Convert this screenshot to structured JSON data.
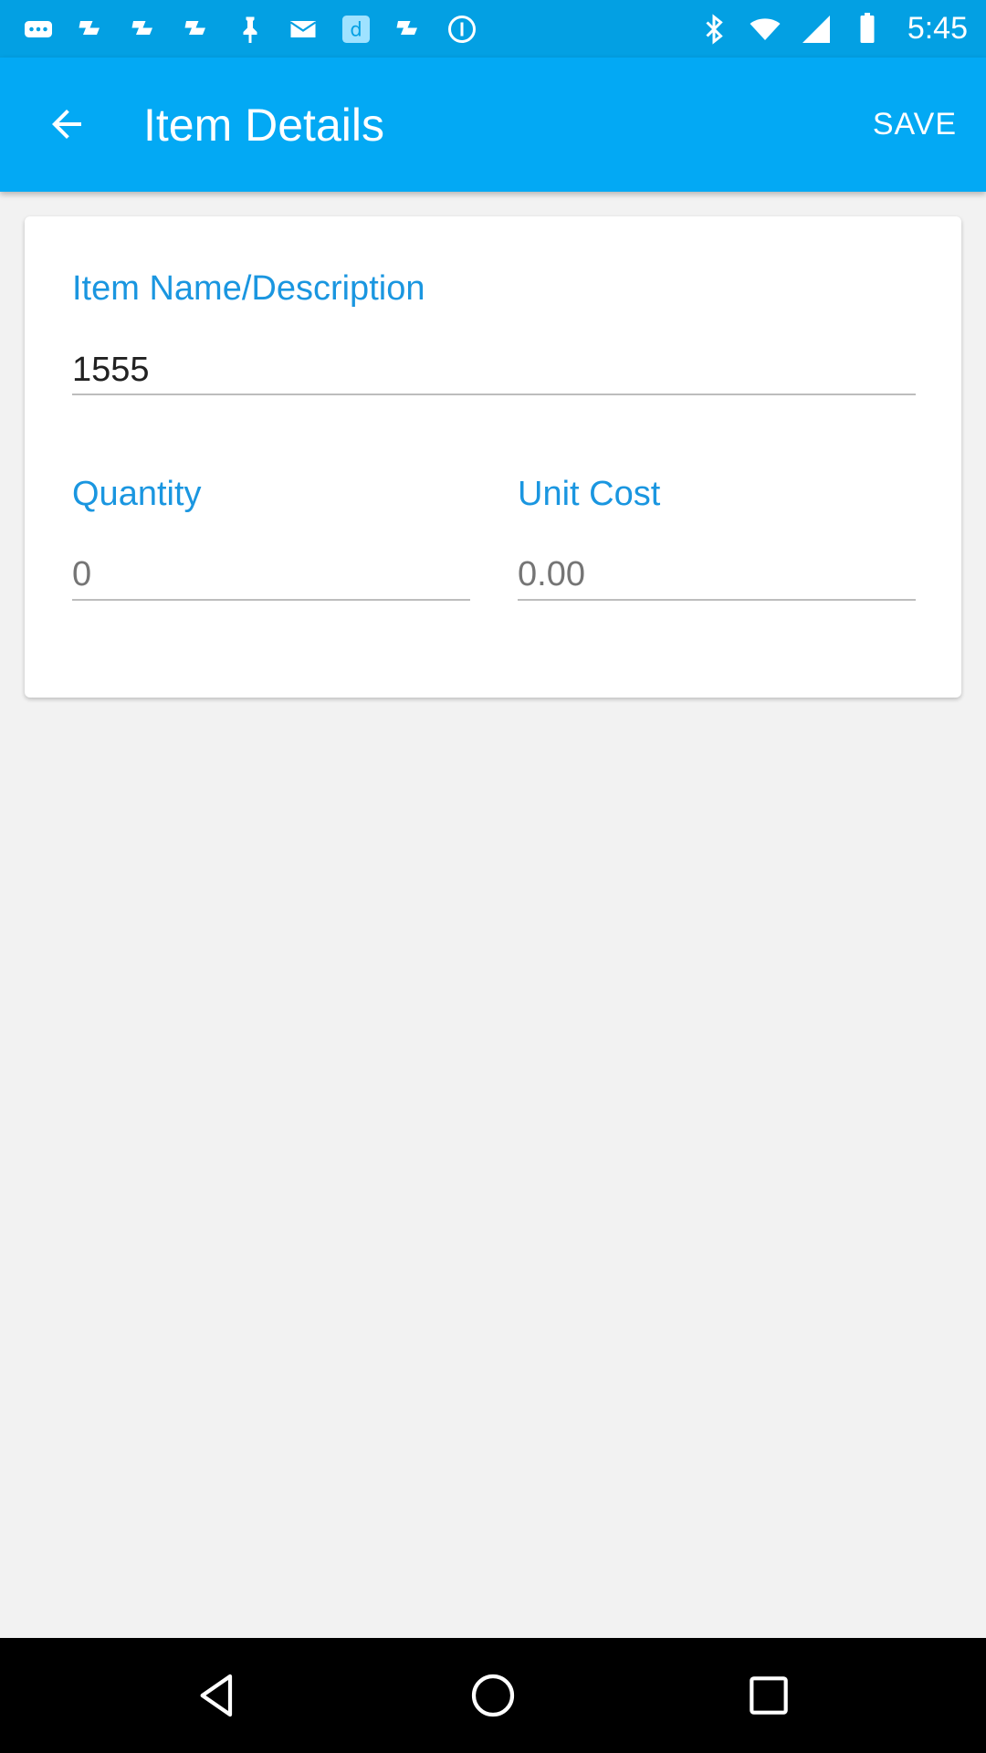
{
  "status_bar": {
    "time": "5:45",
    "left_icons": [
      "more-icon",
      "fan-icon",
      "fan-icon",
      "fan-icon",
      "pin-icon",
      "mail-icon",
      "d-app-icon",
      "fan-icon",
      "info-icon"
    ],
    "right_icons": [
      "bluetooth-icon",
      "wifi-icon",
      "signal-icon",
      "battery-icon"
    ]
  },
  "app_bar": {
    "title": "Item Details",
    "save_label": "SAVE",
    "color": "#03a9f4"
  },
  "form": {
    "item_name": {
      "label": "Item Name/Description",
      "value": "1555"
    },
    "quantity": {
      "label": "Quantity",
      "placeholder": "0"
    },
    "unit_cost": {
      "label": "Unit Cost",
      "placeholder": "0.00"
    },
    "accent_color": "#1a96e0"
  },
  "nav_bar": {
    "buttons": [
      "back-triangle-icon",
      "home-circle-icon",
      "recents-square-icon"
    ]
  }
}
